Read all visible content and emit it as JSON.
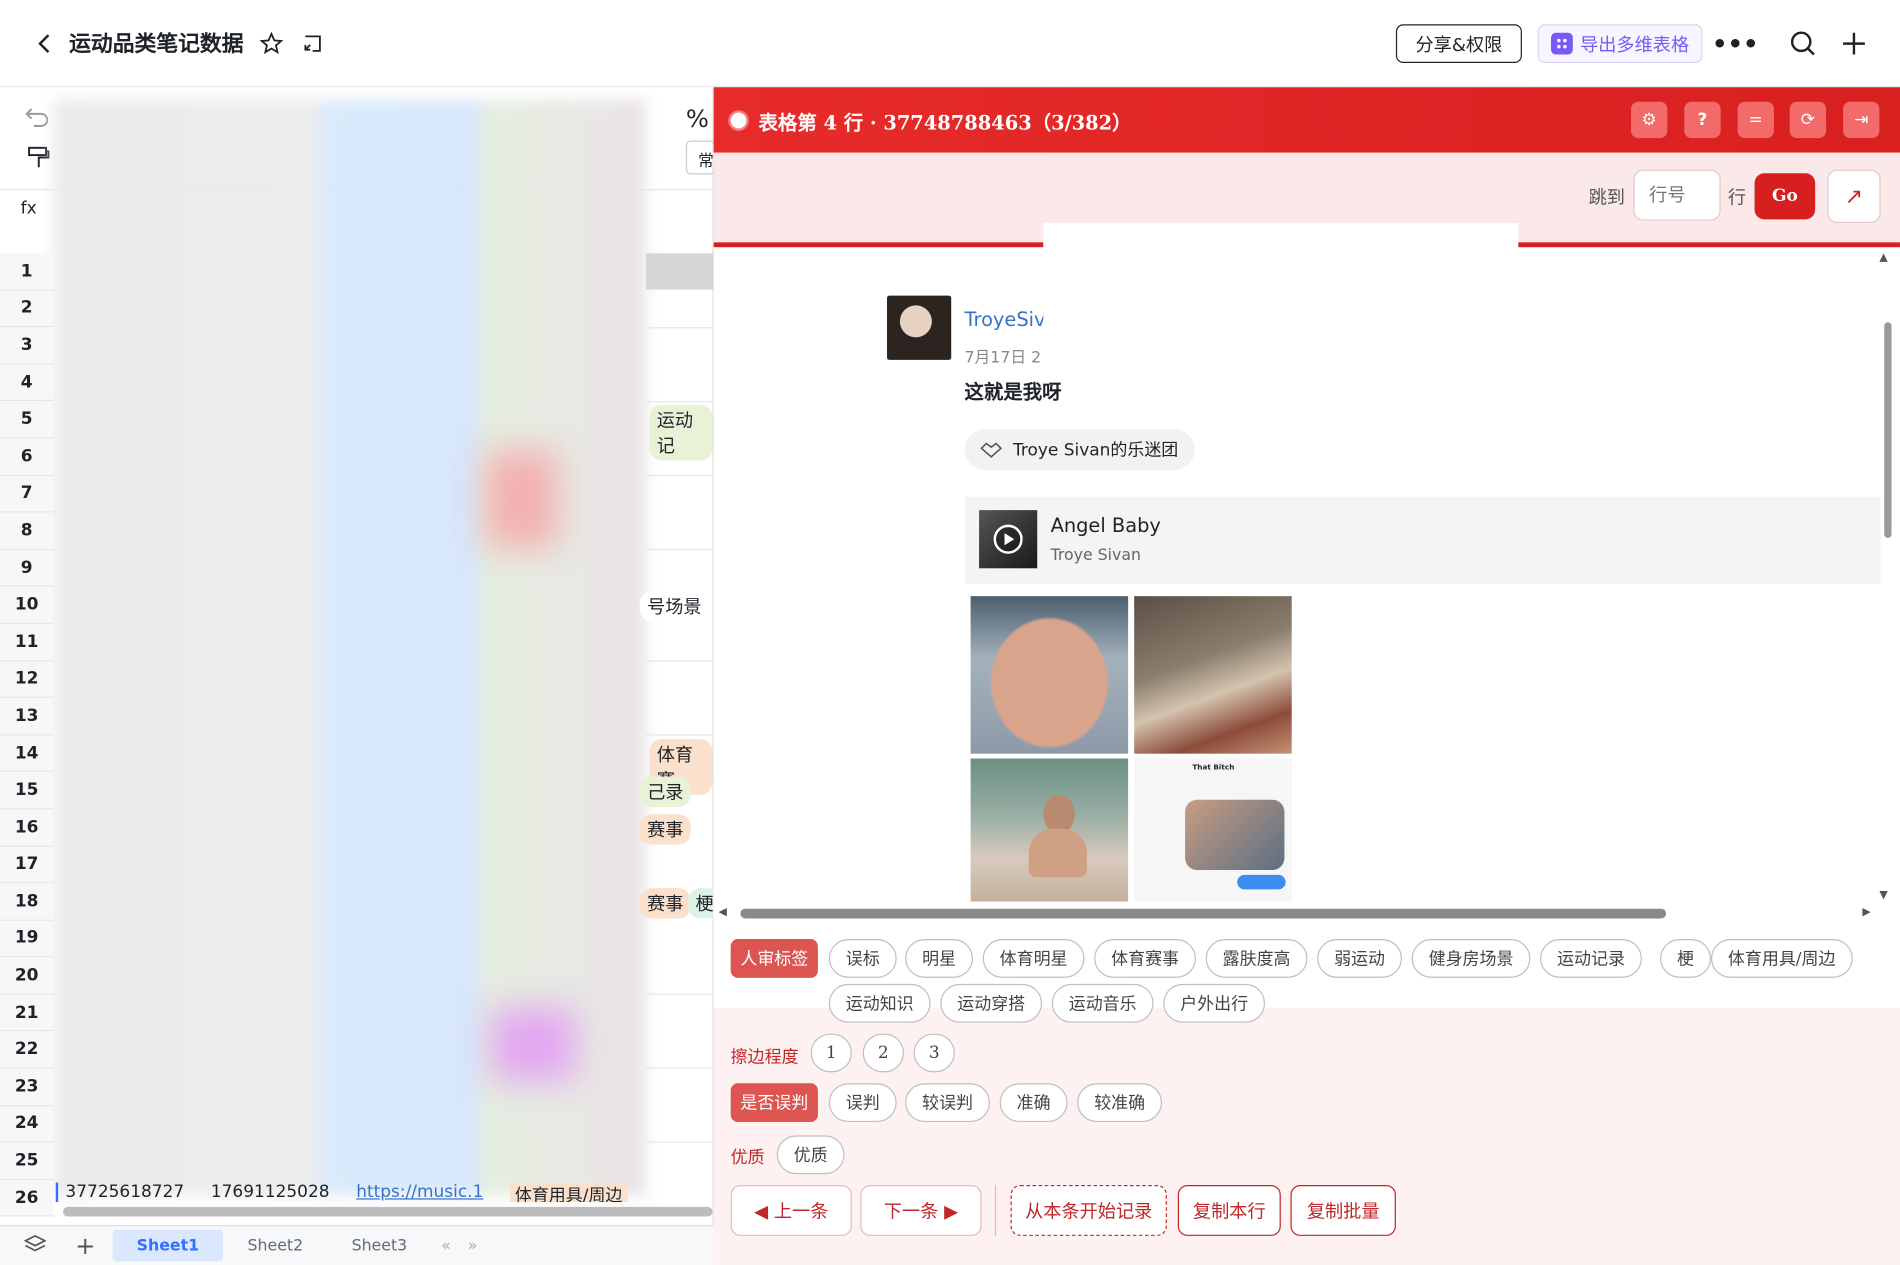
{
  "header": {
    "title": "运动品类笔记数据",
    "share_label": "分享&权限",
    "export_label": "导出多维表格"
  },
  "sheet": {
    "fx_label": "fx",
    "row_numbers": [
      "1",
      "2",
      "3",
      "4",
      "5",
      "6",
      "7",
      "8",
      "9",
      "10",
      "11",
      "12",
      "13",
      "14",
      "15",
      "16",
      "17",
      "18",
      "19",
      "20",
      "21",
      "22",
      "23",
      "24",
      "25",
      "26"
    ],
    "last_row": [
      "37725618727",
      "17691125028",
      "https://music.1",
      "体育用具/周边"
    ],
    "visible_tag_fragments": [
      "运动记",
      "号场景",
      "体育赛",
      "己录",
      "赛事",
      "赛事",
      "梗",
      "常"
    ],
    "tabs": [
      "Sheet1",
      "Sheet2",
      "Sheet3"
    ],
    "active_tab": "Sheet1"
  },
  "panel": {
    "title": "表格第 4 行 · 37748788463（3/382）",
    "jump_label": "跳到",
    "row_placeholder": "行号",
    "row_suffix": "行",
    "go_label": "Go"
  },
  "post": {
    "author": "TroyeSiv",
    "date": "7月17日 2",
    "text": "这就是我呀",
    "circle": "Troye Sivan的乐迷团",
    "music": {
      "title": "Angel Baby",
      "artist": "Troye Sivan"
    },
    "thumb_caption": "That Bitch"
  },
  "tags": {
    "review_label": "人审标签",
    "review_options": [
      "误标",
      "明星",
      "体育明星",
      "体育赛事",
      "露肤度高",
      "弱运动",
      "健身房场景",
      "运动记录",
      "梗",
      "体育用具/周边",
      "运动知识",
      "运动穿搭",
      "运动音乐",
      "户外出行"
    ],
    "edge_label": "擦边程度",
    "edge_options": [
      "1",
      "2",
      "3"
    ],
    "misjudge_label": "是否误判",
    "misjudge_options": [
      "误判",
      "较误判",
      "准确",
      "较准确"
    ],
    "quality_label": "优质",
    "quality_options": [
      "优质"
    ]
  },
  "nav": {
    "prev": "◀ 上一条",
    "next": "下一条 ▶",
    "start": "从本条开始记录",
    "copy_row": "复制本行",
    "copy_batch": "复制批量"
  },
  "colors": {
    "accent": "#d81f1f",
    "panel_bg": "#fdf1f1",
    "link": "#3473c5"
  }
}
